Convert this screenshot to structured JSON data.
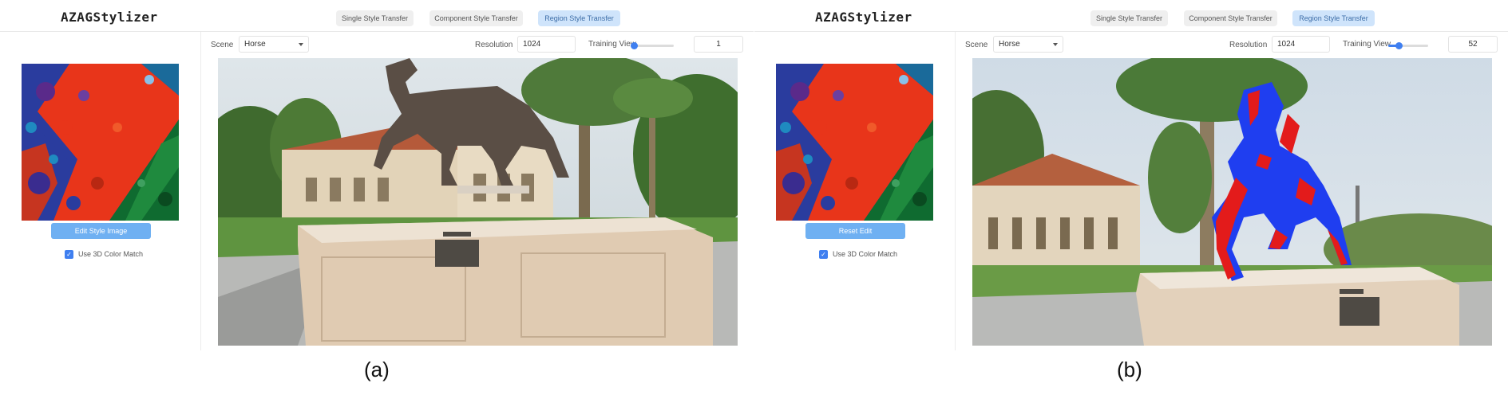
{
  "panels": [
    {
      "logo": "AZAGStylizer",
      "tabs": [
        "Single Style Transfer",
        "Component Style Transfer",
        "Region Style Transfer"
      ],
      "active_tab": "Region Style Transfer",
      "scene_label": "Scene",
      "scene_value": "Horse",
      "resolution_label": "Resolution",
      "resolution_value": "1024",
      "training_view_label": "Training View",
      "training_view_value": "1",
      "slider_fraction": 0.0,
      "style_button": "Edit Style Image",
      "color_match_label": "Use 3D Color Match",
      "color_match_checked": true,
      "viewport_content": "bronze horse statue on beige pedestal",
      "caption": "(a)"
    },
    {
      "logo": "AZAGStylizer",
      "tabs": [
        "Single Style Transfer",
        "Component Style Transfer",
        "Region Style Transfer"
      ],
      "active_tab": "Region Style Transfer",
      "scene_label": "Scene",
      "scene_value": "Horse",
      "resolution_label": "Resolution",
      "resolution_value": "1024",
      "training_view_label": "Training View",
      "training_view_value": "52",
      "slider_fraction": 0.25,
      "style_button": "Reset Edit",
      "color_match_label": "Use 3D Color Match",
      "color_match_checked": true,
      "viewport_content": "horse statue stylized in blue and red",
      "caption": "(b)"
    }
  ],
  "colors": {
    "accent": "#3f7ff0",
    "button": "#6fb0f2",
    "active_tab": "#cfe4fb",
    "style_red": "#e8351a",
    "style_blue": "#2a3c9e",
    "style_green": "#0f6b30",
    "stylized_blue": "#1f3ef0",
    "stylized_red": "#e31b1b"
  },
  "icons": {
    "dropdown": "chevron-down-icon",
    "checkbox": "checkmark-icon"
  }
}
